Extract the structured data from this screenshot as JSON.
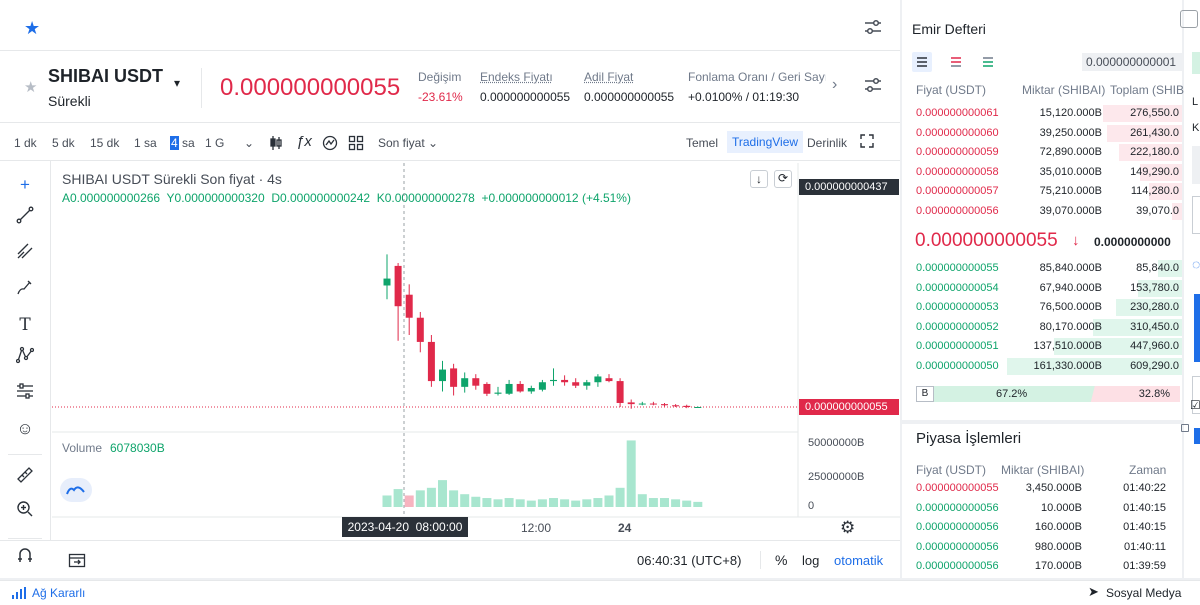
{
  "symbol": {
    "name": "SHIBAI USDT",
    "type": "Sürekli"
  },
  "price": "0.000000000055",
  "stats": [
    {
      "label": "Değişim",
      "value": "-23.61%",
      "color": "red"
    },
    {
      "label": "Endeks Fiyatı",
      "value": "0.000000000055",
      "color": "dark"
    },
    {
      "label": "Adil Fiyat",
      "value": "0.000000000055",
      "color": "dark"
    },
    {
      "label": "Fonlama Oranı / Geri Sayım",
      "value": "+0.0100% / 01:19:30",
      "color": "dark"
    }
  ],
  "timeframes": [
    "1 dk",
    "5 dk",
    "15 dk",
    "1 sa",
    "4 sa",
    "1 G"
  ],
  "active_timeframe": "4 sa",
  "price_type": "Son fiyat",
  "view_tabs": [
    "Temel",
    "TradingView",
    "Derinlik"
  ],
  "active_view": "TradingView",
  "legend": {
    "title": "SHIBAI USDT Sürekli Son fiyat · 4s",
    "ohlc": "A0.000000000266  Y0.000000000320  D0.000000000242  K0.000000000278  +0.000000000012 (+4.51%)"
  },
  "price_axis": {
    "top_label": "0.000000000437",
    "last_label": "0.000000000055"
  },
  "volume": {
    "label": "Volume",
    "value": "6078030B",
    "ticks": [
      "50000000B",
      "25000000B",
      "0"
    ]
  },
  "time_axis": {
    "cursor_label": "2023-04-20  08:00:00",
    "ticks": [
      "12:00",
      "24"
    ]
  },
  "bottom_bar": {
    "clock": "06:40:31 (UTC+8)",
    "percent": "%",
    "log": "log",
    "auto": "otomatik"
  },
  "orderbook": {
    "title": "Emir Defteri",
    "precision": "0.000000000001",
    "headers": [
      "Fiyat (USDT)",
      "Miktar (SHIBAI)",
      "Toplam (SHIB"
    ],
    "asks": [
      {
        "price": "0.000000000061",
        "amount": "15,120.000B",
        "total": "276,550.0",
        "depth": 0.45
      },
      {
        "price": "0.000000000060",
        "amount": "39,250.000B",
        "total": "261,430.0",
        "depth": 0.43
      },
      {
        "price": "0.000000000059",
        "amount": "72,890.000B",
        "total": "222,180.0",
        "depth": 0.36
      },
      {
        "price": "0.000000000058",
        "amount": "35,010.000B",
        "total": "149,290.0",
        "depth": 0.24
      },
      {
        "price": "0.000000000057",
        "amount": "75,210.000B",
        "total": "114,280.0",
        "depth": 0.19
      },
      {
        "price": "0.000000000056",
        "amount": "39,070.000B",
        "total": "39,070.0",
        "depth": 0.06
      }
    ],
    "mid_price": "0.000000000055",
    "mid_mark": "0.0000000000",
    "bids": [
      {
        "price": "0.000000000055",
        "amount": "85,840.000B",
        "total": "85,840.0",
        "depth": 0.14
      },
      {
        "price": "0.000000000054",
        "amount": "67,940.000B",
        "total": "153,780.0",
        "depth": 0.25
      },
      {
        "price": "0.000000000053",
        "amount": "76,500.000B",
        "total": "230,280.0",
        "depth": 0.38
      },
      {
        "price": "0.000000000052",
        "amount": "80,170.000B",
        "total": "310,450.0",
        "depth": 0.51
      },
      {
        "price": "0.000000000051",
        "amount": "137,510.000B",
        "total": "447,960.0",
        "depth": 0.73
      },
      {
        "price": "0.000000000050",
        "amount": "161,330.000B",
        "total": "609,290.0",
        "depth": 1.0
      }
    ],
    "buy_label": "B",
    "buy_pct": "67.2%",
    "sell_pct": "32.8%",
    "buy_ratio": 0.672
  },
  "trades": {
    "title": "Piyasa İşlemleri",
    "headers": [
      "Fiyat (USDT)",
      "Miktar (SHIBAI)",
      "Zaman"
    ],
    "rows": [
      {
        "price": "0.000000000055",
        "amount": "3,450.000B",
        "time": "01:40:22",
        "side": "sell"
      },
      {
        "price": "0.000000000056",
        "amount": "10.000B",
        "time": "01:40:15",
        "side": "buy"
      },
      {
        "price": "0.000000000056",
        "amount": "160.000B",
        "time": "01:40:15",
        "side": "buy"
      },
      {
        "price": "0.000000000056",
        "amount": "980.000B",
        "time": "01:40:11",
        "side": "buy"
      },
      {
        "price": "0.000000000056",
        "amount": "170.000B",
        "time": "01:39:59",
        "side": "buy"
      }
    ]
  },
  "right_cut": [
    "L",
    "K"
  ],
  "footer": {
    "status": "Ağ Kararlı",
    "social": "Sosyal Medya"
  },
  "colors": {
    "up": "#0ea46b",
    "down": "#e0294a",
    "accent": "#1e6ee8",
    "up_vol": "#a8e6cf",
    "down_vol": "#f7b4c0"
  },
  "candles": [
    {
      "o": 2.66e-10,
      "h": 3.2e-10,
      "l": 2.42e-10,
      "c": 2.78e-10
    },
    {
      "o": 3e-10,
      "h": 3.05e-10,
      "l": 1.7e-10,
      "c": 2.3e-10
    },
    {
      "o": 2.5e-10,
      "h": 2.68e-10,
      "l": 1.8e-10,
      "c": 2.1e-10
    },
    {
      "o": 2.1e-10,
      "h": 2.2e-10,
      "l": 1.5e-10,
      "c": 1.68e-10
    },
    {
      "o": 1.68e-10,
      "h": 1.8e-10,
      "l": 9e-11,
      "c": 1e-10
    },
    {
      "o": 1e-10,
      "h": 1.35e-10,
      "l": 8.2e-11,
      "c": 1.2e-10
    },
    {
      "o": 1.22e-10,
      "h": 1.3e-10,
      "l": 7.5e-11,
      "c": 9e-11
    },
    {
      "o": 9e-11,
      "h": 1.15e-10,
      "l": 8e-11,
      "c": 1.05e-10
    },
    {
      "o": 1.05e-10,
      "h": 1.12e-10,
      "l": 8.5e-11,
      "c": 9.2e-11
    },
    {
      "o": 9.5e-11,
      "h": 9.8e-11,
      "l": 7.4e-11,
      "c": 7.8e-11
    },
    {
      "o": 7.8e-11,
      "h": 9e-11,
      "l": 7.5e-11,
      "c": 8e-11
    },
    {
      "o": 7.8e-11,
      "h": 1.02e-10,
      "l": 7.6e-11,
      "c": 9.5e-11
    },
    {
      "o": 9.5e-11,
      "h": 1e-10,
      "l": 8e-11,
      "c": 8.2e-11
    },
    {
      "o": 8.2e-11,
      "h": 9.2e-11,
      "l": 7.8e-11,
      "c": 8.8e-11
    },
    {
      "o": 8.5e-11,
      "h": 1.02e-10,
      "l": 8.2e-11,
      "c": 9.8e-11
    },
    {
      "o": 1e-10,
      "h": 1.22e-10,
      "l": 9.2e-11,
      "c": 1.02e-10
    },
    {
      "o": 1.02e-10,
      "h": 1.1e-10,
      "l": 9.2e-11,
      "c": 9.8e-11
    },
    {
      "o": 9.8e-11,
      "h": 1.05e-10,
      "l": 8.8e-11,
      "c": 9.2e-11
    },
    {
      "o": 9.2e-11,
      "h": 1.02e-10,
      "l": 8.5e-11,
      "c": 9.8e-11
    },
    {
      "o": 9.8e-11,
      "h": 1.12e-10,
      "l": 9e-11,
      "c": 1.08e-10
    },
    {
      "o": 1.05e-10,
      "h": 1.12e-10,
      "l": 9.8e-11,
      "c": 1e-10
    },
    {
      "o": 1e-10,
      "h": 1.05e-10,
      "l": 5.5e-11,
      "c": 6.2e-11
    },
    {
      "o": 6.3e-11,
      "h": 6.8e-11,
      "l": 5.2e-11,
      "c": 6e-11
    },
    {
      "o": 6e-11,
      "h": 6.4e-11,
      "l": 5.8e-11,
      "c": 6.1e-11
    },
    {
      "o": 6.1e-11,
      "h": 6.4e-11,
      "l": 5.8e-11,
      "c": 6e-11
    },
    {
      "o": 6e-11,
      "h": 6.2e-11,
      "l": 5.6e-11,
      "c": 5.8e-11
    },
    {
      "o": 5.8e-11,
      "h": 6e-11,
      "l": 5.5e-11,
      "c": 5.7e-11
    },
    {
      "o": 5.7e-11,
      "h": 5.9e-11,
      "l": 5.3e-11,
      "c": 5.5e-11
    },
    {
      "o": 5.5e-11,
      "h": 5.6e-11,
      "l": 5.4e-11,
      "c": 5.5e-11
    }
  ],
  "volumes": [
    9000000,
    14000000,
    9000000,
    13000000,
    15000000,
    21000000,
    13000000,
    10000000,
    8000000,
    7000000,
    6000000,
    7000000,
    6000000,
    5000000,
    6000000,
    7000000,
    6000000,
    5000000,
    6000000,
    7000000,
    9000000,
    15000000,
    52000000,
    10000000,
    7000000,
    7000000,
    6000000,
    5000000,
    4000000
  ]
}
